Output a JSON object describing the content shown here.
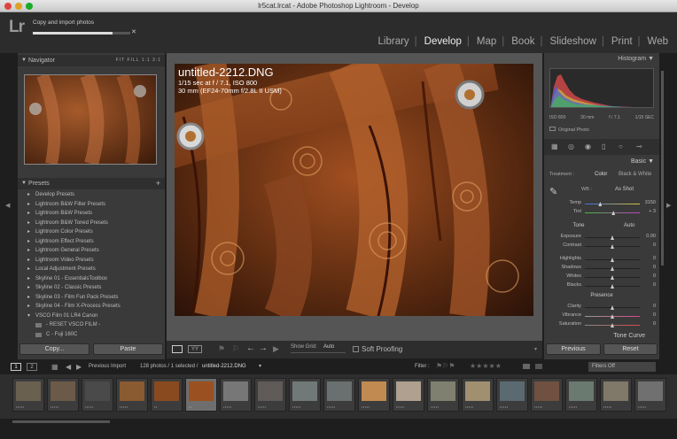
{
  "window_title": "lr5cat.lrcat - Adobe Photoshop Lightroom - Develop",
  "app_logo": "Lr",
  "task": {
    "label": "Copy and import photos",
    "progress": 0.82
  },
  "modules": [
    "Library",
    "Develop",
    "Map",
    "Book",
    "Slideshow",
    "Print",
    "Web"
  ],
  "active_module": "Develop",
  "navigator": {
    "title": "Navigator",
    "options": "FIT FILL 1:1 3:1"
  },
  "presets": {
    "title": "Presets",
    "add": "+",
    "items": [
      {
        "label": "Develop Presets",
        "type": "folder"
      },
      {
        "label": "Lightroom B&W Filter Presets",
        "type": "folder"
      },
      {
        "label": "Lightroom B&W Presets",
        "type": "folder"
      },
      {
        "label": "Lightroom B&W Toned Presets",
        "type": "folder"
      },
      {
        "label": "Lightroom Color Presets",
        "type": "folder"
      },
      {
        "label": "Lightroom Effect Presets",
        "type": "folder"
      },
      {
        "label": "Lightroom General Presets",
        "type": "folder"
      },
      {
        "label": "Lightroom Video Presets",
        "type": "folder"
      },
      {
        "label": "Local Adjustment Presets",
        "type": "folder"
      },
      {
        "label": "Skyline 01 - EssentialsToolbox",
        "type": "folder"
      },
      {
        "label": "Skyline 02 - Classic Presets",
        "type": "folder"
      },
      {
        "label": "Skyline 03 - Film Fun Pack Presets",
        "type": "folder"
      },
      {
        "label": "Skyline 04 - Film X-Process Presets",
        "type": "folder"
      },
      {
        "label": "VSCO Film 01 LR4 Canon",
        "type": "open"
      },
      {
        "label": "- RESET VSCO FILM -",
        "type": "sub"
      },
      {
        "label": "C - Fuji 160C",
        "type": "sub"
      }
    ]
  },
  "left_buttons": {
    "copy": "Copy...",
    "paste": "Paste"
  },
  "photo": {
    "filename": "untitled-2212.DNG",
    "exposure": "1/15 sec at f / 7.1, ISO 800",
    "lens": "30 mm (EF24-70mm f/2.8L II USM)"
  },
  "toolbar": {
    "show_grid_label": "Show Grid:",
    "show_grid_value": "Auto",
    "soft_proofing": "Soft Proofing"
  },
  "histogram": {
    "title": "Histogram",
    "iso": "ISO 800",
    "focal": "30 mm",
    "aperture": "f / 7.1",
    "shutter": "1/15 SEC",
    "original": "Original Photo"
  },
  "basic": {
    "title": "Basic",
    "treatment_label": "Treatment :",
    "color": "Color",
    "bw": "Black & White",
    "wb_label": "WB :",
    "wb_value": "As Shot",
    "tone_label": "Tone",
    "auto": "Auto",
    "presence_label": "Presence",
    "sliders": [
      {
        "label": "Temp",
        "value": "3150",
        "pos": 0.28
      },
      {
        "label": "Tint",
        "value": "+ 3",
        "pos": 0.52
      },
      {
        "label": "Exposure",
        "value": "0.00",
        "pos": 0.5
      },
      {
        "label": "Contrast",
        "value": "0",
        "pos": 0.5
      },
      {
        "label": "Highlights",
        "value": "0",
        "pos": 0.5
      },
      {
        "label": "Shadows",
        "value": "0",
        "pos": 0.5
      },
      {
        "label": "Whites",
        "value": "0",
        "pos": 0.5
      },
      {
        "label": "Blacks",
        "value": "0",
        "pos": 0.5
      },
      {
        "label": "Clarity",
        "value": "0",
        "pos": 0.5
      },
      {
        "label": "Vibrance",
        "value": "0",
        "pos": 0.5
      },
      {
        "label": "Saturation",
        "value": "0",
        "pos": 0.5
      }
    ]
  },
  "tone_curve": "Tone Curve",
  "right_buttons": {
    "previous": "Previous",
    "reset": "Reset"
  },
  "filmstrip_bar": {
    "page1": "1",
    "page2": "2",
    "source": "Previous Import",
    "count": "128 photos / 1 selected /",
    "selected": "untitled-2212.DNG",
    "filter_label": "Filter :",
    "filter_value": "Filters Off"
  },
  "thumbnails": [
    {
      "color": "#6a6050",
      "stars": "•••••"
    },
    {
      "color": "#6b5a48",
      "stars": "•••••"
    },
    {
      "color": "#4a4a4a",
      "stars": "•••••"
    },
    {
      "color": "#8a5a30",
      "stars": "•••••"
    },
    {
      "color": "#8a4a20",
      "stars": "••"
    },
    {
      "color": "#9a5020",
      "stars": "••"
    },
    {
      "color": "#777777",
      "stars": "•••••"
    },
    {
      "color": "#605a58",
      "stars": "•••••"
    },
    {
      "color": "#707878",
      "stars": "•••••"
    },
    {
      "color": "#6a7070",
      "stars": "•••••"
    },
    {
      "color": "#c08a50",
      "stars": "•••••"
    },
    {
      "color": "#b0a090",
      "stars": "•••••"
    },
    {
      "color": "#808070",
      "stars": "•••••"
    },
    {
      "color": "#a09070",
      "stars": "•••••"
    },
    {
      "color": "#5a6a70",
      "stars": "•••••"
    },
    {
      "color": "#705040",
      "stars": "•••••"
    },
    {
      "color": "#6a7a70",
      "stars": "•••••"
    },
    {
      "color": "#807868",
      "stars": "•••••"
    },
    {
      "color": "#707070",
      "stars": "•••••"
    }
  ]
}
